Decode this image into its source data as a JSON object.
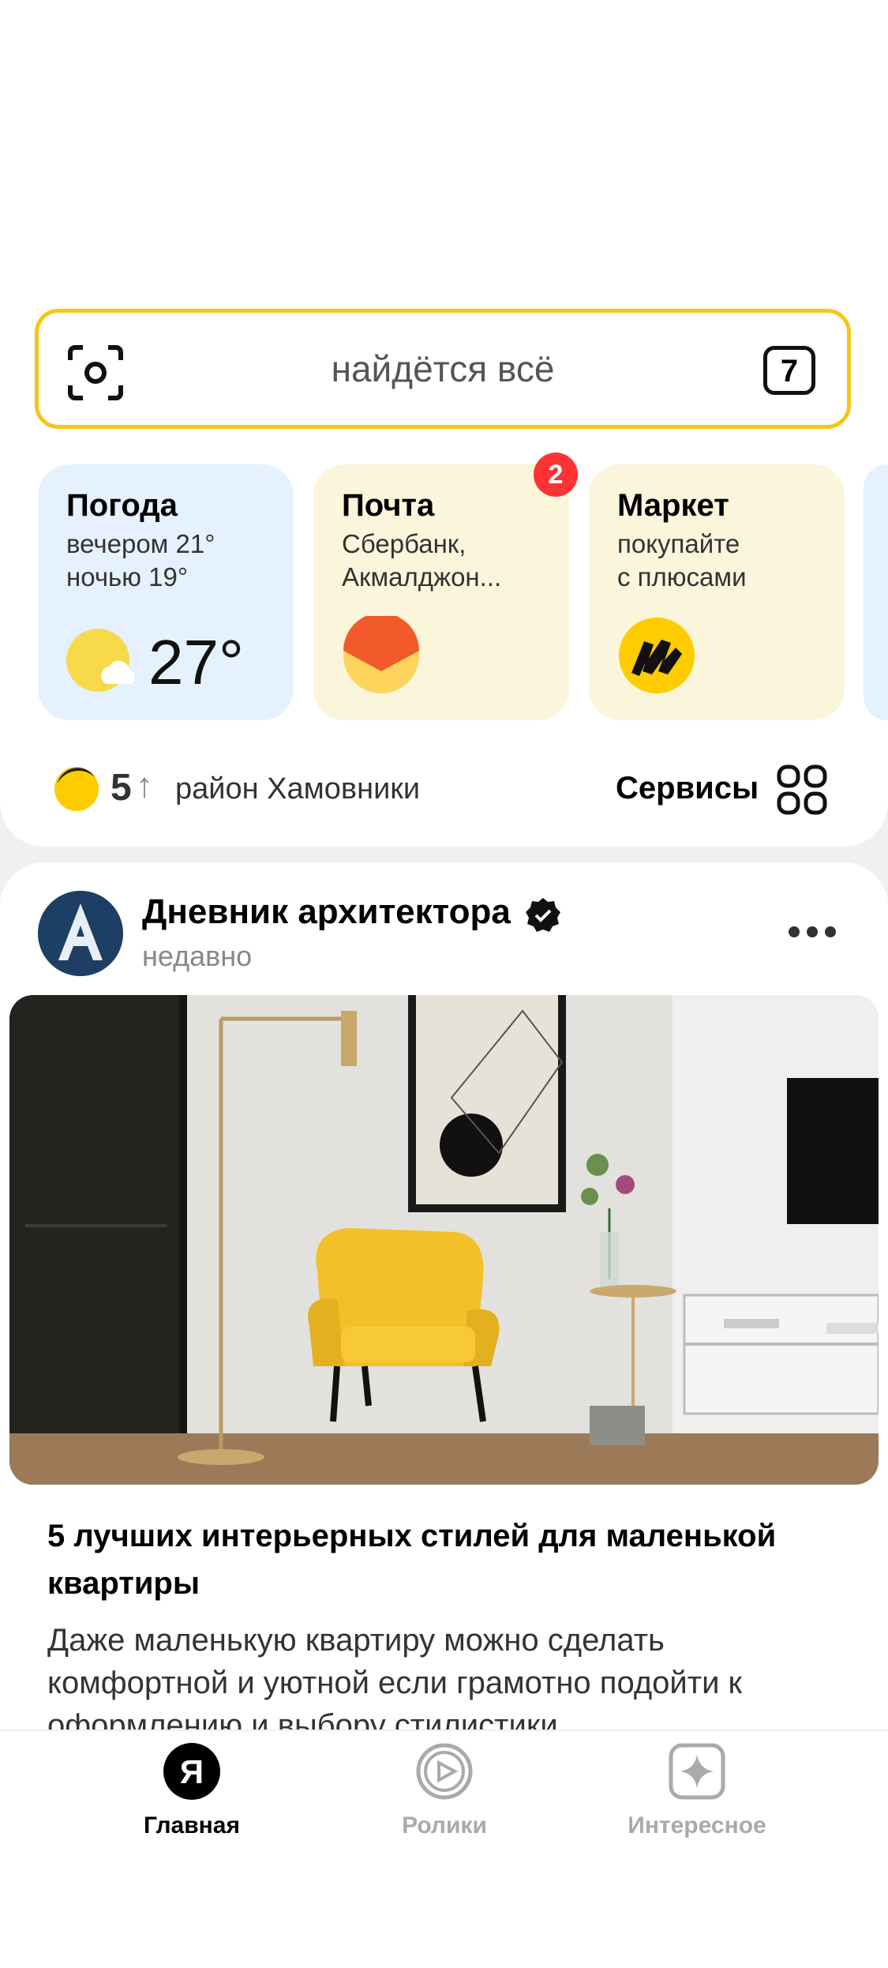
{
  "search": {
    "placeholder": "найдётся всё",
    "tabs_count": "7"
  },
  "cards": [
    {
      "title": "Погода",
      "sub1": "вечером 21°",
      "sub2": "ночью 19°",
      "temp": "27°",
      "icon": "sun-cloud-icon"
    },
    {
      "title": "Почта",
      "sub1": "Сбербанк,",
      "sub2": "Акмалджон...",
      "badge": "2",
      "icon": "mail-envelope-icon"
    },
    {
      "title": "Маркет",
      "sub1": "покупайте",
      "sub2": "с плюсами",
      "icon": "market-logo-icon"
    }
  ],
  "status": {
    "score": "5",
    "arrow": "↑",
    "region": "район Хамовники",
    "services": "Сервисы"
  },
  "post": {
    "channel": "Дневник архитектора",
    "time": "недавно",
    "headline": "5 лучших интерьерных стилей для маленькой квартиры",
    "lead": "Даже маленькую квартиру можно сделать комфортной и уютной если грамотно подойти к оформлению и выбору стилистики"
  },
  "tabbar": [
    {
      "label": "Главная",
      "active": true
    },
    {
      "label": "Ролики",
      "active": false
    },
    {
      "label": "Интересное",
      "active": false
    }
  ],
  "colors": {
    "accent": "#f5c518",
    "badge": "#ff3333",
    "weather_card": "#e6f1ff",
    "card": "#fbf5dc"
  }
}
